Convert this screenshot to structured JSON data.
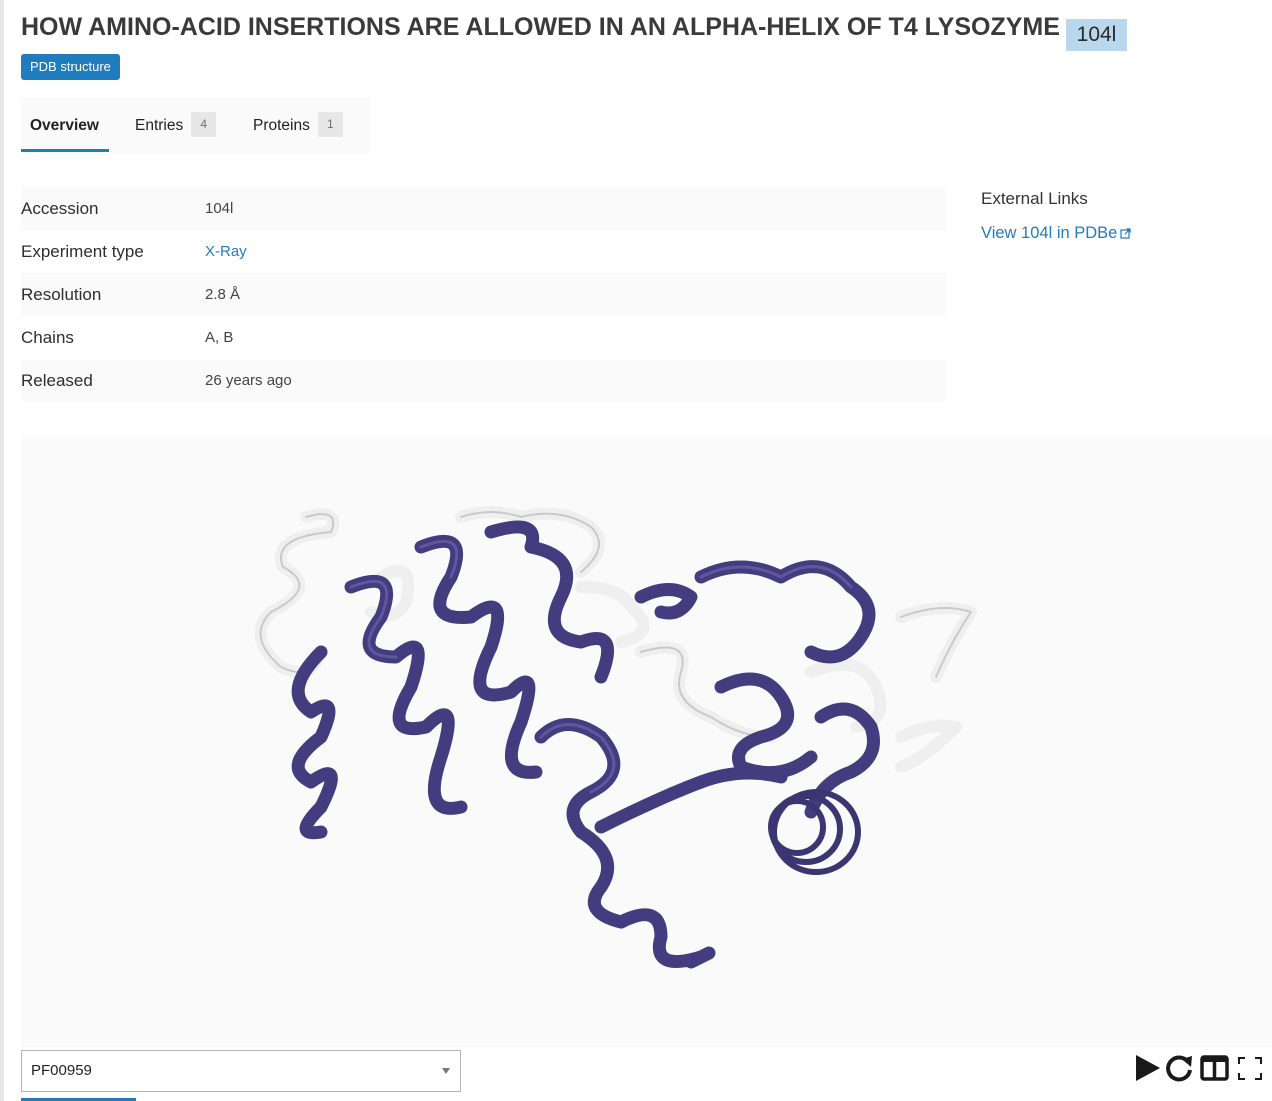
{
  "header": {
    "title": "HOW AMINO-ACID INSERTIONS ARE ALLOWED IN AN ALPHA-HELIX OF T4 LYSOZYME",
    "accession_badge": "104l",
    "type_tag": "PDB structure"
  },
  "tabs": [
    {
      "label": "Overview",
      "count": null,
      "active": true
    },
    {
      "label": "Entries",
      "count": "4",
      "active": false
    },
    {
      "label": "Proteins",
      "count": "1",
      "active": false
    }
  ],
  "details": [
    {
      "key": "Accession",
      "value": "104l",
      "link": false
    },
    {
      "key": "Experiment type",
      "value": "X-Ray",
      "link": true
    },
    {
      "key": "Resolution",
      "value": "2.8 Å",
      "link": false
    },
    {
      "key": "Chains",
      "value": "A, B",
      "link": false
    },
    {
      "key": "Released",
      "value": "26 years ago",
      "link": false
    }
  ],
  "external_links": {
    "title": "External Links",
    "link_label": "View 104l in PDBe"
  },
  "viewer": {
    "selected_option": "PF00959",
    "controls": [
      "play-icon",
      "redo-icon",
      "split-view-icon",
      "fullscreen-icon"
    ],
    "colors": {
      "highlighted": "#443c7f",
      "other": "#f0f0f0",
      "background": "#fafafa"
    }
  },
  "colors": {
    "accent": "#1f7cbd",
    "badge": "#b9d8ee"
  }
}
